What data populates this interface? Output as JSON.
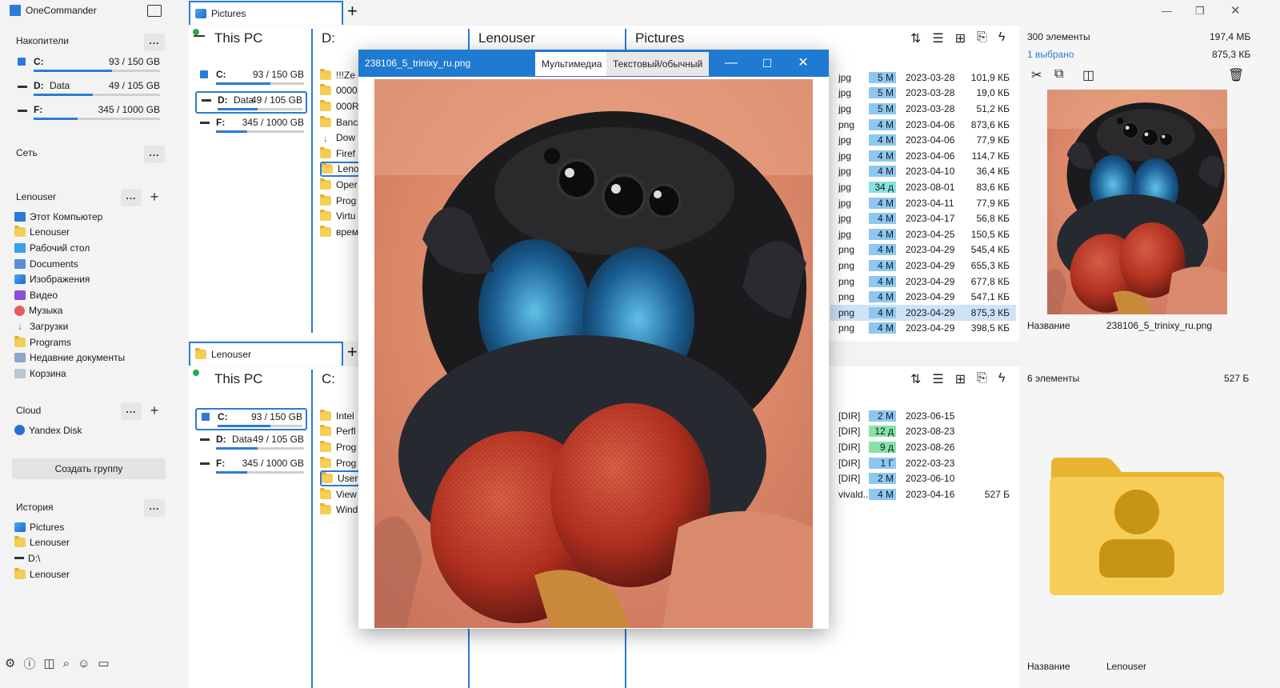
{
  "app": {
    "title": "OneCommander"
  },
  "sidebar": {
    "drives_header": "Накопители",
    "drives": [
      {
        "name": "C:",
        "label": "",
        "usage": "93 / 150 GB",
        "fill": 0.62
      },
      {
        "name": "D:",
        "label": "Data",
        "usage": "49 / 105 GB",
        "fill": 0.47
      },
      {
        "name": "F:",
        "label": "",
        "usage": "345 / 1000 GB",
        "fill": 0.35
      }
    ],
    "network_header": "Сеть",
    "user_header": "Lenouser",
    "user_items": [
      {
        "label": "Этот Компьютер",
        "icon": "computer-icon"
      },
      {
        "label": "Lenouser",
        "icon": "folder-icon"
      },
      {
        "label": "Рабочий стол",
        "icon": "desktop-icon"
      },
      {
        "label": "Documents",
        "icon": "documents-icon"
      },
      {
        "label": "Изображения",
        "icon": "pictures-icon"
      },
      {
        "label": "Видео",
        "icon": "video-icon"
      },
      {
        "label": "Музыка",
        "icon": "music-icon"
      },
      {
        "label": "Загрузки",
        "icon": "download-icon"
      },
      {
        "label": "Programs",
        "icon": "folder-icon"
      },
      {
        "label": "Недавние документы",
        "icon": "recent-icon"
      },
      {
        "label": "Корзина",
        "icon": "recycle-bin-icon"
      }
    ],
    "cloud_header": "Cloud",
    "cloud_items": [
      {
        "label": "Yandex Disk",
        "icon": "yandex-disk-icon"
      }
    ],
    "create_group": "Создать группу",
    "history_header": "История",
    "history_items": [
      {
        "label": "Pictures",
        "icon": "pictures-icon"
      },
      {
        "label": "Lenouser",
        "icon": "folder-icon"
      },
      {
        "label": "D:\\",
        "icon": "drive-icon"
      },
      {
        "label": "Lenouser",
        "icon": "folder-icon"
      }
    ],
    "dots": "...",
    "plus": "+"
  },
  "top_pane": {
    "tab_label": "Pictures",
    "col1_header": "This PC",
    "col2_header": "D:",
    "col3_header": "Lenouser",
    "col4_header": "Pictures",
    "drives": [
      {
        "name": "C:",
        "label": "",
        "usage": "93 / 150 GB",
        "fill": 0.62
      },
      {
        "name": "D:",
        "label": "Data",
        "usage": "49 / 105 GB",
        "fill": 0.47
      },
      {
        "name": "F:",
        "label": "",
        "usage": "345 / 1000 GB",
        "fill": 0.35
      }
    ],
    "d_items": [
      "!!!Ze",
      "0000",
      "000R",
      "Banc",
      "Dow",
      "Firef",
      "Leno",
      "Oper",
      "Prog",
      "Virtu",
      "врем"
    ],
    "status_count": "300 элементы",
    "status_size": "197,4 МБ",
    "status_selected": "1 выбрано",
    "status_selected_size": "875,3 КБ",
    "files": [
      {
        "ext": "jpg",
        "age": "5 М",
        "date": "2023-03-28",
        "size": "101,9 КБ",
        "c": ""
      },
      {
        "ext": "jpg",
        "age": "5 М",
        "date": "2023-03-28",
        "size": "19,0 КБ",
        "c": ""
      },
      {
        "ext": "jpg",
        "age": "5 М",
        "date": "2023-03-28",
        "size": "51,2 КБ",
        "c": ""
      },
      {
        "ext": "png",
        "age": "4 М",
        "date": "2023-04-06",
        "size": "873,6 КБ",
        "c": ""
      },
      {
        "ext": "jpg",
        "age": "4 М",
        "date": "2023-04-06",
        "size": "77,9 КБ",
        "c": ""
      },
      {
        "ext": "jpg",
        "age": "4 М",
        "date": "2023-04-06",
        "size": "114,7 КБ",
        "c": ""
      },
      {
        "ext": "jpg",
        "age": "4 М",
        "date": "2023-04-10",
        "size": "36,4 КБ",
        "c": ""
      },
      {
        "ext": "jpg",
        "age": "34 д",
        "date": "2023-08-01",
        "size": "83,6 КБ",
        "c": "c"
      },
      {
        "ext": "jpg",
        "age": "4 М",
        "date": "2023-04-11",
        "size": "77,9 КБ",
        "c": ""
      },
      {
        "ext": "jpg",
        "age": "4 М",
        "date": "2023-04-17",
        "size": "56,8 КБ",
        "c": ""
      },
      {
        "ext": "jpg",
        "age": "4 М",
        "date": "2023-04-25",
        "size": "150,5 КБ",
        "c": ""
      },
      {
        "ext": "png",
        "age": "4 М",
        "date": "2023-04-29",
        "size": "545,4 КБ",
        "c": ""
      },
      {
        "ext": "png",
        "age": "4 М",
        "date": "2023-04-29",
        "size": "655,3 КБ",
        "c": ""
      },
      {
        "ext": "png",
        "age": "4 М",
        "date": "2023-04-29",
        "size": "677,8 КБ",
        "c": ""
      },
      {
        "ext": "png",
        "age": "4 М",
        "date": "2023-04-29",
        "size": "547,1 КБ",
        "c": ""
      },
      {
        "ext": "png",
        "age": "4 М",
        "date": "2023-04-29",
        "size": "875,3 КБ",
        "c": "",
        "selected": true
      },
      {
        "ext": "png",
        "age": "4 М",
        "date": "2023-04-29",
        "size": "398,5 КБ",
        "c": ""
      }
    ],
    "prop_name_label": "Название",
    "prop_name_value": "238106_5_trinixy_ru.png"
  },
  "bottom_pane": {
    "tab_label": "Lenouser",
    "col1_header": "This PC",
    "col2_header": "C:",
    "drives": [
      {
        "name": "C:",
        "label": "",
        "usage": "93 / 150 GB",
        "fill": 0.62
      },
      {
        "name": "D:",
        "label": "Data",
        "usage": "49 / 105 GB",
        "fill": 0.47
      },
      {
        "name": "F:",
        "label": "",
        "usage": "345 / 1000 GB",
        "fill": 0.35
      }
    ],
    "c_items": [
      "Intel",
      "Perfl",
      "Prog",
      "Prog",
      "Users",
      "View",
      "Wind"
    ],
    "status_count": "6 элементы",
    "status_size": "527 Б",
    "files": [
      {
        "ext": "[DIR]",
        "age": "2 М",
        "date": "2023-06-15",
        "size": "",
        "c": ""
      },
      {
        "ext": "[DIR]",
        "age": "12 д",
        "date": "2023-08-23",
        "size": "",
        "c": "g"
      },
      {
        "ext": "[DIR]",
        "age": "9 д",
        "date": "2023-08-26",
        "size": "",
        "c": "g"
      },
      {
        "ext": "[DIR]",
        "age": "1 Г",
        "date": "2022-03-23",
        "size": "",
        "c": ""
      },
      {
        "ext": "[DIR]",
        "age": "2 М",
        "date": "2023-06-10",
        "size": "",
        "c": ""
      },
      {
        "ext": "vivald...",
        "age": "4 М",
        "date": "2023-04-16",
        "size": "527 Б",
        "c": ""
      }
    ],
    "prop_name_label": "Название",
    "prop_name_value": "Lenouser"
  },
  "viewer": {
    "title": "238106_5_trinixy_ru.png",
    "tab_media": "Мультимедиа",
    "tab_text": "Текстовый/обычный"
  },
  "colors": {
    "accent": "#2b7bd6",
    "titlebar": "#1f7ad1"
  }
}
